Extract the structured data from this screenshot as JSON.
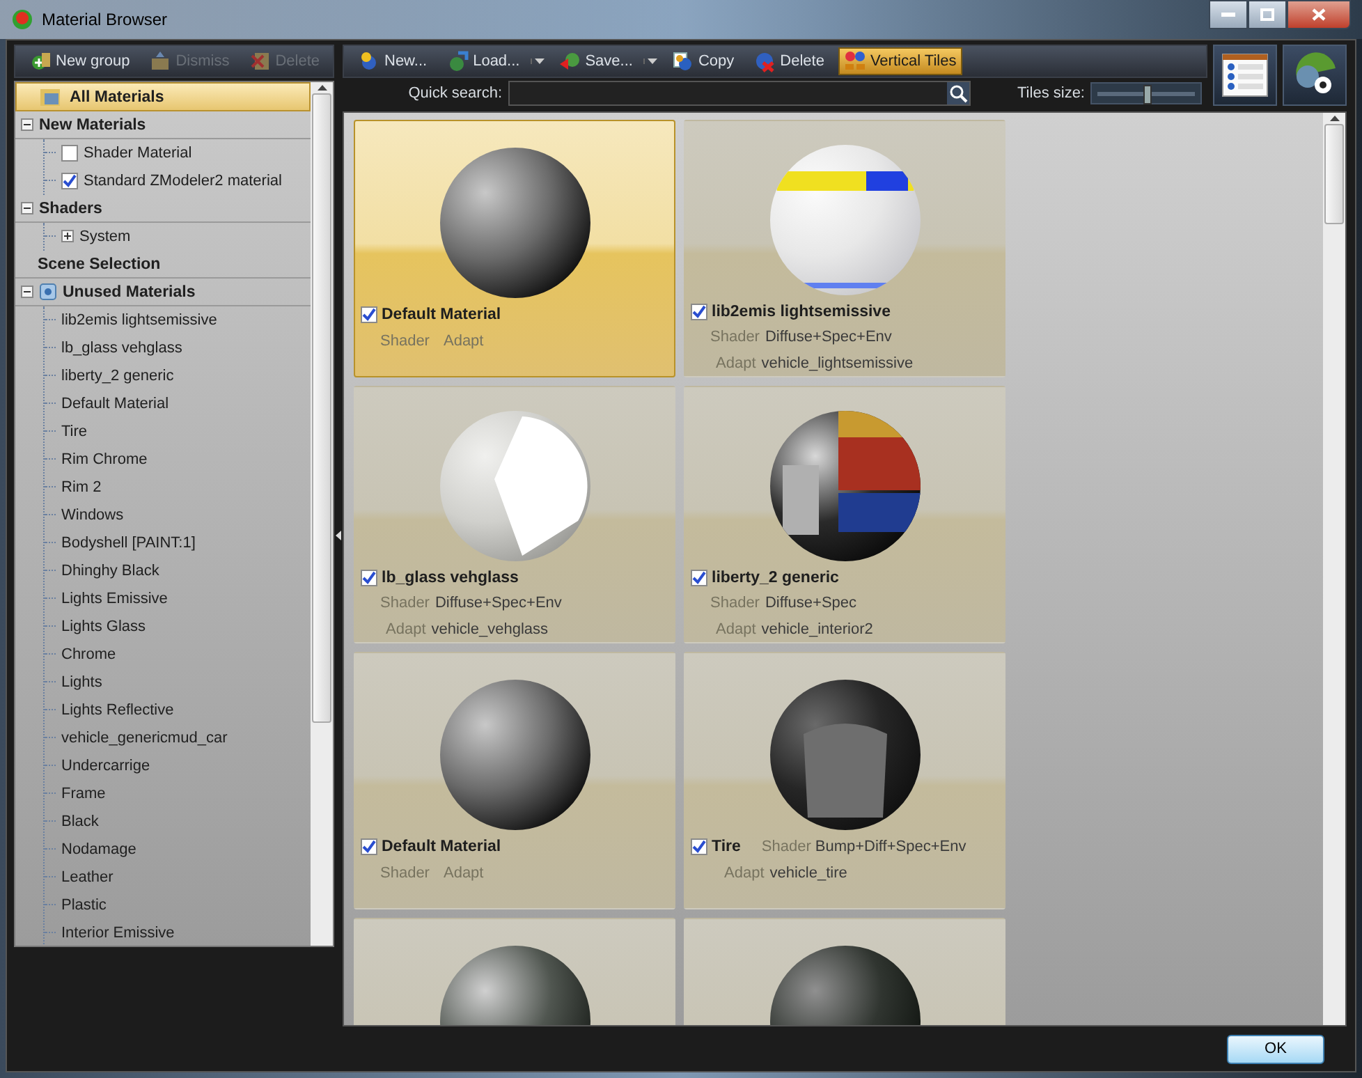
{
  "window": {
    "title": "Material Browser"
  },
  "left_toolbar": [
    {
      "label": "New group",
      "kind": "add",
      "disabled": false
    },
    {
      "label": "Dismiss",
      "kind": "folder-up",
      "disabled": true
    },
    {
      "label": "Delete",
      "kind": "remove",
      "disabled": true
    }
  ],
  "tree": [
    {
      "label": "All Materials",
      "kind": "root",
      "selected": true
    },
    {
      "label": "New Materials",
      "kind": "group",
      "expanded": true,
      "selected": false,
      "children": [
        {
          "label": "Shader Material",
          "checked": false,
          "selected": false
        },
        {
          "label": "Standard ZModeler2 material",
          "checked": true,
          "selected": false
        }
      ]
    },
    {
      "label": "Shaders",
      "kind": "group",
      "expanded": true,
      "selected": false,
      "children": [
        {
          "label": "System",
          "expanded": false,
          "selected": false
        }
      ]
    },
    {
      "label": "Scene Selection",
      "kind": "group",
      "selected": false
    },
    {
      "label": "Unused Materials",
      "kind": "icon-group",
      "expanded": true,
      "selected": false,
      "children": [
        {
          "label": "lib2emis lightsemissive",
          "selected": false
        },
        {
          "label": "lb_glass vehglass",
          "selected": false
        },
        {
          "label": "liberty_2 generic",
          "selected": false
        },
        {
          "label": "Default Material",
          "selected": false
        },
        {
          "label": "Tire",
          "selected": false
        },
        {
          "label": "Rim Chrome",
          "selected": false
        },
        {
          "label": "Rim 2",
          "selected": false
        },
        {
          "label": "Windows",
          "selected": false
        },
        {
          "label": "Bodyshell [PAINT:1]",
          "selected": false
        },
        {
          "label": "Dhinghy Black",
          "selected": false
        },
        {
          "label": "Lights Emissive",
          "selected": false
        },
        {
          "label": "Lights Glass",
          "selected": false
        },
        {
          "label": "Chrome",
          "selected": false
        },
        {
          "label": "Lights",
          "selected": false
        },
        {
          "label": "Lights Reflective",
          "selected": false
        },
        {
          "label": "vehicle_genericmud_car",
          "selected": false
        },
        {
          "label": "Undercarrige",
          "selected": false
        },
        {
          "label": "Frame",
          "selected": false
        },
        {
          "label": "Black",
          "selected": false
        },
        {
          "label": "Nodamage",
          "selected": false
        },
        {
          "label": "Leather",
          "selected": false
        },
        {
          "label": "Plastic",
          "selected": false
        },
        {
          "label": "Interior Emissive",
          "selected": false
        }
      ]
    }
  ],
  "toolbar": [
    {
      "label": "New...",
      "kind": "new",
      "dropdown": false,
      "on": false
    },
    {
      "label": "Load...",
      "kind": "load",
      "dropdown": true,
      "on": false
    },
    {
      "label": "Save...",
      "kind": "save",
      "dropdown": true,
      "on": false
    },
    {
      "label": "Copy",
      "kind": "copy",
      "dropdown": false,
      "on": false
    },
    {
      "label": "Delete",
      "kind": "delete",
      "dropdown": false,
      "on": false
    },
    {
      "label": "Vertical Tiles",
      "kind": "tiles",
      "dropdown": false,
      "on": true
    }
  ],
  "search": {
    "label": "Quick search:"
  },
  "tiles_size": {
    "label": "Tiles size:",
    "level": 0.5
  },
  "tiles": [
    {
      "kind": "stacked",
      "preview": {
        "kind": "matte"
      },
      "name": "Default Material",
      "checked": true,
      "selected": true,
      "shader_label": "Shader",
      "adapt_label": "Adapt"
    },
    {
      "kind": "stacked",
      "preview": {
        "kind": "emissive"
      },
      "name": "lib2emis lightsemissive",
      "checked": true,
      "selected": false,
      "shader_label": "Shader",
      "shader": "Diffuse+Spec+Env",
      "adapt_label": "Adapt",
      "adapt": "vehicle_lightsemissive"
    },
    {
      "kind": "stacked",
      "preview": {
        "kind": "glass"
      },
      "name": "lb_glass vehglass",
      "checked": true,
      "selected": false,
      "shader_label": "Shader",
      "shader": "Diffuse+Spec+Env",
      "adapt_label": "Adapt",
      "adapt": "vehicle_vehglass"
    },
    {
      "kind": "stacked",
      "preview": {
        "kind": "painted"
      },
      "name": "liberty_2 generic",
      "checked": true,
      "selected": false,
      "shader_label": "Shader",
      "shader": "Diffuse+Spec",
      "adapt_label": "Adapt",
      "adapt": "vehicle_interior2"
    },
    {
      "kind": "stacked",
      "preview": {
        "kind": "matte"
      },
      "name": "Default Material",
      "checked": true,
      "selected": false,
      "shader_label": "Shader",
      "adapt_label": "Adapt"
    },
    {
      "kind": "inline",
      "preview": {
        "kind": "tire"
      },
      "name": "Tire",
      "checked": true,
      "selected": false,
      "shader_label": "Shader",
      "shader": "Bump+Diff+Spec+Env",
      "adapt_label": "Adapt",
      "adapt": "vehicle_tire"
    },
    {
      "kind": "preview",
      "preview": {
        "kind": "dirty"
      }
    },
    {
      "kind": "preview",
      "preview": {
        "kind": "dark"
      }
    }
  ],
  "ok_button": "OK"
}
